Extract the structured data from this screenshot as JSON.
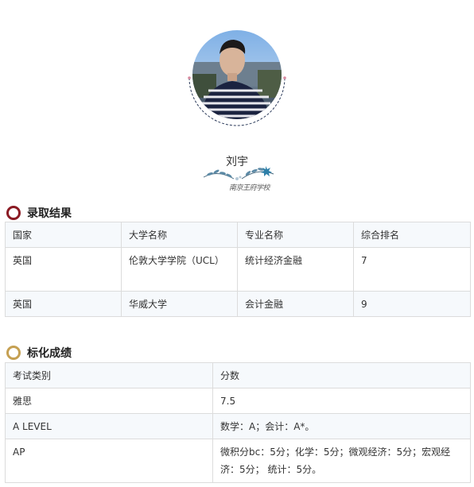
{
  "profile": {
    "name": "刘宇",
    "school_logo_text": "南京王府学校"
  },
  "admission": {
    "title": "录取结果",
    "headers": [
      "国家",
      "大学名称",
      "专业名称",
      "综合排名"
    ],
    "rows": [
      [
        "英国",
        "伦敦大学学院（UCL）",
        "统计经济金融",
        "7"
      ],
      [
        "英国",
        "华威大学",
        "会计金融",
        "9"
      ]
    ]
  },
  "scores": {
    "title": "标化成绩",
    "headers": [
      "考试类别",
      "分数"
    ],
    "rows": [
      [
        "雅思",
        "7.5"
      ],
      [
        "A LEVEL",
        "数学：A；会计：A*。"
      ],
      [
        "AP",
        "微积分bc：5分；化学：5分；微观经济：5分；宏观经济：5分； 统计：5分。"
      ]
    ]
  },
  "colors": {
    "admission_icon": "#8b1b24",
    "scores_icon": "#c5a052",
    "row_alt": "#f6f9fc",
    "border": "#dcdcdc"
  }
}
